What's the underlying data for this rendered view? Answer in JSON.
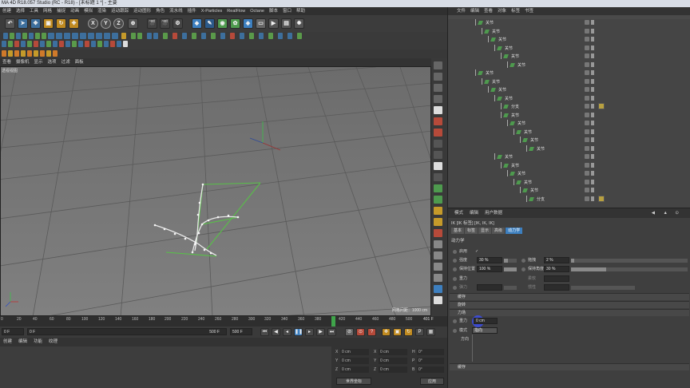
{
  "window_title": "MA 4D R18.057 Studio (RC - R18) - [未标题 1 *] - 主要",
  "menu": [
    "创建",
    "选择",
    "工具",
    "网格",
    "捕捉",
    "动画",
    "模拟",
    "渲染",
    "运动跟踪",
    "运动图形",
    "角色",
    "流水线",
    "插件",
    "X-Particles",
    "RealFlow",
    "Octane",
    "脚本",
    "窗口",
    "帮助"
  ],
  "toolbar": {
    "xyz": [
      "X",
      "Y",
      "Z"
    ]
  },
  "viewport": {
    "menu": [
      "查看",
      "摄像机",
      "显示",
      "选项",
      "过滤",
      "面板"
    ],
    "label": "透视视图",
    "grid_status": "网格间距：1000 cm"
  },
  "timeline": {
    "ticks": [
      "0",
      "20",
      "40",
      "60",
      "80",
      "100",
      "120",
      "140",
      "160",
      "180",
      "200",
      "220",
      "240",
      "260",
      "280",
      "300",
      "320",
      "340",
      "360",
      "380",
      "400",
      "420",
      "440",
      "460",
      "480",
      "500"
    ],
    "current": "401 F"
  },
  "anim": {
    "start": "0 F",
    "range_start": "0 F",
    "range_end": "500 F",
    "end": "500 F"
  },
  "material": {
    "menu": [
      "创建",
      "编辑",
      "功能",
      "纹理"
    ]
  },
  "coords": {
    "rows": [
      [
        "X",
        "0 cm",
        "X",
        "0 cm",
        "H",
        "0°"
      ],
      [
        "Y",
        "0 cm",
        "Y",
        "0 cm",
        "P",
        "0°"
      ],
      [
        "Z",
        "0 cm",
        "Z",
        "0 cm",
        "B",
        "0°"
      ]
    ],
    "world": "世界坐标",
    "apply": "应用"
  },
  "objects": {
    "menu": [
      "文件",
      "编辑",
      "查看",
      "对象",
      "标签",
      "书签"
    ],
    "rows": [
      {
        "label": "关节",
        "indent": 38
      },
      {
        "label": "关节",
        "indent": 46
      },
      {
        "label": "关节",
        "indent": 54
      },
      {
        "label": "关节",
        "indent": 62
      },
      {
        "label": "关节",
        "indent": 70
      },
      {
        "label": "关节",
        "indent": 78
      },
      {
        "label": "关节",
        "indent": 38
      },
      {
        "label": "关节",
        "indent": 46
      },
      {
        "label": "关节",
        "indent": 54
      },
      {
        "label": "关节",
        "indent": 62
      },
      {
        "label": "分支",
        "indent": 70,
        "tag": true
      },
      {
        "label": "关节",
        "indent": 70
      },
      {
        "label": "关节",
        "indent": 78
      },
      {
        "label": "关节",
        "indent": 86
      },
      {
        "label": "关节",
        "indent": 94
      },
      {
        "label": "关节",
        "indent": 102
      },
      {
        "label": "关节",
        "indent": 62
      },
      {
        "label": "关节",
        "indent": 70
      },
      {
        "label": "关节",
        "indent": 78
      },
      {
        "label": "关节",
        "indent": 86
      },
      {
        "label": "关节",
        "indent": 94
      },
      {
        "label": "分支",
        "indent": 102,
        "tag": true
      }
    ]
  },
  "attributes": {
    "menu": [
      "模式",
      "编辑",
      "用户数据"
    ],
    "title": "IK [IK 标签] [IK, IK, IK]",
    "tabs": [
      "基本",
      "标签",
      "显示",
      "高级",
      "动力学"
    ],
    "active_tab": "动力学",
    "section": "动力学",
    "enable_label": "启用",
    "strength_label": "强度",
    "strength_value": "30 %",
    "strength_fraction": 0.3,
    "keep_pos_label": "保持位置",
    "keep_pos_value": "100 %",
    "drag_label": "拖拽",
    "drag_value": "2 %",
    "keep_pos2_label": "保持角度",
    "keep_pos2_value": "30 %",
    "gravity_label": "重力",
    "bounce_label": "弹力",
    "softness_label": "柔软",
    "inertia_label": "惯性",
    "sections": [
      "缓存",
      "旋转",
      "力场"
    ],
    "gravity_field_label": "重力",
    "gravity_field_value": "0 cm",
    "mode_label": "模式",
    "mode_value": "指向",
    "direction_label": "方向",
    "bottom_section": "缓存"
  }
}
